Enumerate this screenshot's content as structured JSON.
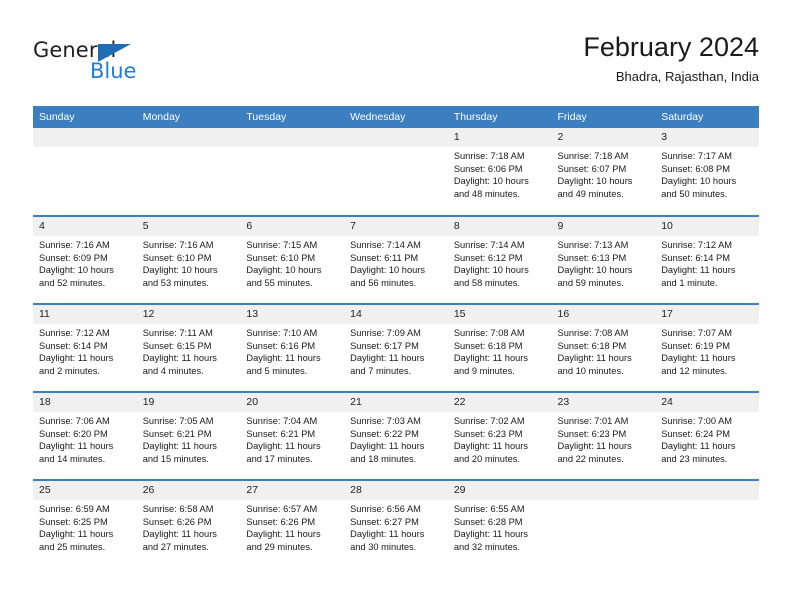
{
  "brand": {
    "name_top": "General",
    "name_bottom": "Blue",
    "triangle_color": "#1f6db4",
    "blue_color": "#1f7fd4"
  },
  "header": {
    "title": "February 2024",
    "subtitle": "Bhadra, Rajasthan, India"
  },
  "theme": {
    "header_bg": "#3c7fc1",
    "daynum_bg": "#f0f0f0",
    "text": "#1a1a1a"
  },
  "weekdays": [
    "Sunday",
    "Monday",
    "Tuesday",
    "Wednesday",
    "Thursday",
    "Friday",
    "Saturday"
  ],
  "weeks": [
    [
      {
        "day": "",
        "lines": []
      },
      {
        "day": "",
        "lines": []
      },
      {
        "day": "",
        "lines": []
      },
      {
        "day": "",
        "lines": []
      },
      {
        "day": "1",
        "lines": [
          "Sunrise: 7:18 AM",
          "Sunset: 6:06 PM",
          "Daylight: 10 hours",
          "and 48 minutes."
        ]
      },
      {
        "day": "2",
        "lines": [
          "Sunrise: 7:18 AM",
          "Sunset: 6:07 PM",
          "Daylight: 10 hours",
          "and 49 minutes."
        ]
      },
      {
        "day": "3",
        "lines": [
          "Sunrise: 7:17 AM",
          "Sunset: 6:08 PM",
          "Daylight: 10 hours",
          "and 50 minutes."
        ]
      }
    ],
    [
      {
        "day": "4",
        "lines": [
          "Sunrise: 7:16 AM",
          "Sunset: 6:09 PM",
          "Daylight: 10 hours",
          "and 52 minutes."
        ]
      },
      {
        "day": "5",
        "lines": [
          "Sunrise: 7:16 AM",
          "Sunset: 6:10 PM",
          "Daylight: 10 hours",
          "and 53 minutes."
        ]
      },
      {
        "day": "6",
        "lines": [
          "Sunrise: 7:15 AM",
          "Sunset: 6:10 PM",
          "Daylight: 10 hours",
          "and 55 minutes."
        ]
      },
      {
        "day": "7",
        "lines": [
          "Sunrise: 7:14 AM",
          "Sunset: 6:11 PM",
          "Daylight: 10 hours",
          "and 56 minutes."
        ]
      },
      {
        "day": "8",
        "lines": [
          "Sunrise: 7:14 AM",
          "Sunset: 6:12 PM",
          "Daylight: 10 hours",
          "and 58 minutes."
        ]
      },
      {
        "day": "9",
        "lines": [
          "Sunrise: 7:13 AM",
          "Sunset: 6:13 PM",
          "Daylight: 10 hours",
          "and 59 minutes."
        ]
      },
      {
        "day": "10",
        "lines": [
          "Sunrise: 7:12 AM",
          "Sunset: 6:14 PM",
          "Daylight: 11 hours",
          "and 1 minute."
        ]
      }
    ],
    [
      {
        "day": "11",
        "lines": [
          "Sunrise: 7:12 AM",
          "Sunset: 6:14 PM",
          "Daylight: 11 hours",
          "and 2 minutes."
        ]
      },
      {
        "day": "12",
        "lines": [
          "Sunrise: 7:11 AM",
          "Sunset: 6:15 PM",
          "Daylight: 11 hours",
          "and 4 minutes."
        ]
      },
      {
        "day": "13",
        "lines": [
          "Sunrise: 7:10 AM",
          "Sunset: 6:16 PM",
          "Daylight: 11 hours",
          "and 5 minutes."
        ]
      },
      {
        "day": "14",
        "lines": [
          "Sunrise: 7:09 AM",
          "Sunset: 6:17 PM",
          "Daylight: 11 hours",
          "and 7 minutes."
        ]
      },
      {
        "day": "15",
        "lines": [
          "Sunrise: 7:08 AM",
          "Sunset: 6:18 PM",
          "Daylight: 11 hours",
          "and 9 minutes."
        ]
      },
      {
        "day": "16",
        "lines": [
          "Sunrise: 7:08 AM",
          "Sunset: 6:18 PM",
          "Daylight: 11 hours",
          "and 10 minutes."
        ]
      },
      {
        "day": "17",
        "lines": [
          "Sunrise: 7:07 AM",
          "Sunset: 6:19 PM",
          "Daylight: 11 hours",
          "and 12 minutes."
        ]
      }
    ],
    [
      {
        "day": "18",
        "lines": [
          "Sunrise: 7:06 AM",
          "Sunset: 6:20 PM",
          "Daylight: 11 hours",
          "and 14 minutes."
        ]
      },
      {
        "day": "19",
        "lines": [
          "Sunrise: 7:05 AM",
          "Sunset: 6:21 PM",
          "Daylight: 11 hours",
          "and 15 minutes."
        ]
      },
      {
        "day": "20",
        "lines": [
          "Sunrise: 7:04 AM",
          "Sunset: 6:21 PM",
          "Daylight: 11 hours",
          "and 17 minutes."
        ]
      },
      {
        "day": "21",
        "lines": [
          "Sunrise: 7:03 AM",
          "Sunset: 6:22 PM",
          "Daylight: 11 hours",
          "and 18 minutes."
        ]
      },
      {
        "day": "22",
        "lines": [
          "Sunrise: 7:02 AM",
          "Sunset: 6:23 PM",
          "Daylight: 11 hours",
          "and 20 minutes."
        ]
      },
      {
        "day": "23",
        "lines": [
          "Sunrise: 7:01 AM",
          "Sunset: 6:23 PM",
          "Daylight: 11 hours",
          "and 22 minutes."
        ]
      },
      {
        "day": "24",
        "lines": [
          "Sunrise: 7:00 AM",
          "Sunset: 6:24 PM",
          "Daylight: 11 hours",
          "and 23 minutes."
        ]
      }
    ],
    [
      {
        "day": "25",
        "lines": [
          "Sunrise: 6:59 AM",
          "Sunset: 6:25 PM",
          "Daylight: 11 hours",
          "and 25 minutes."
        ]
      },
      {
        "day": "26",
        "lines": [
          "Sunrise: 6:58 AM",
          "Sunset: 6:26 PM",
          "Daylight: 11 hours",
          "and 27 minutes."
        ]
      },
      {
        "day": "27",
        "lines": [
          "Sunrise: 6:57 AM",
          "Sunset: 6:26 PM",
          "Daylight: 11 hours",
          "and 29 minutes."
        ]
      },
      {
        "day": "28",
        "lines": [
          "Sunrise: 6:56 AM",
          "Sunset: 6:27 PM",
          "Daylight: 11 hours",
          "and 30 minutes."
        ]
      },
      {
        "day": "29",
        "lines": [
          "Sunrise: 6:55 AM",
          "Sunset: 6:28 PM",
          "Daylight: 11 hours",
          "and 32 minutes."
        ]
      },
      {
        "day": "",
        "lines": []
      },
      {
        "day": "",
        "lines": []
      }
    ]
  ]
}
